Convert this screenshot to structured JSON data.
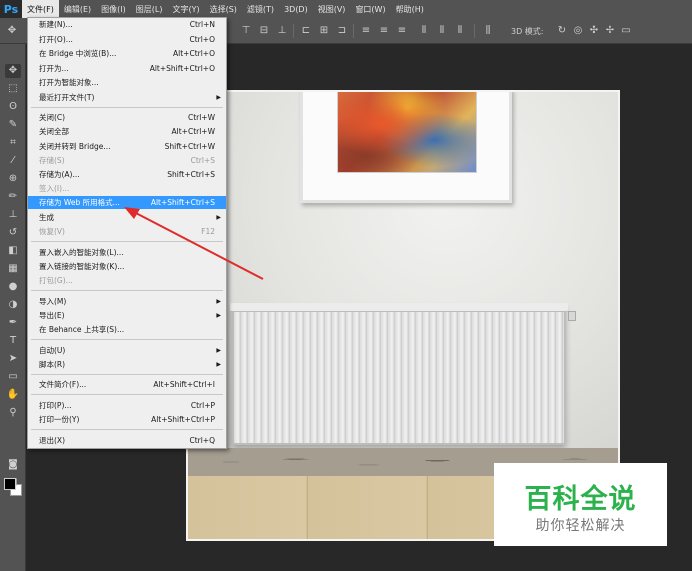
{
  "app": {
    "logo": "Ps"
  },
  "menubar": {
    "items": [
      {
        "label": "文件(F)",
        "active": true
      },
      {
        "label": "编辑(E)"
      },
      {
        "label": "图像(I)"
      },
      {
        "label": "图层(L)"
      },
      {
        "label": "文字(Y)"
      },
      {
        "label": "选择(S)"
      },
      {
        "label": "滤镜(T)"
      },
      {
        "label": "3D(D)"
      },
      {
        "label": "视图(V)"
      },
      {
        "label": "窗口(W)"
      },
      {
        "label": "帮助(H)"
      }
    ]
  },
  "optionsbar": {
    "mode_label": "3D 模式:"
  },
  "file_menu": {
    "items": [
      {
        "label": "新建(N)...",
        "shortcut": "Ctrl+N"
      },
      {
        "label": "打开(O)...",
        "shortcut": "Ctrl+O"
      },
      {
        "label": "在 Bridge 中浏览(B)...",
        "shortcut": "Alt+Ctrl+O"
      },
      {
        "label": "打开为...",
        "shortcut": "Alt+Shift+Ctrl+O"
      },
      {
        "label": "打开为智能对象..."
      },
      {
        "label": "最近打开文件(T)",
        "submenu": true
      },
      {
        "label": "关闭(C)",
        "shortcut": "Ctrl+W"
      },
      {
        "label": "关闭全部",
        "shortcut": "Alt+Ctrl+W"
      },
      {
        "label": "关闭并转到 Bridge...",
        "shortcut": "Shift+Ctrl+W"
      },
      {
        "label": "存储(S)",
        "shortcut": "Ctrl+S",
        "disabled": true
      },
      {
        "label": "存储为(A)...",
        "shortcut": "Shift+Ctrl+S"
      },
      {
        "label": "签入(I)...",
        "disabled": true
      },
      {
        "label": "存储为 Web 所用格式...",
        "shortcut": "Alt+Shift+Ctrl+S",
        "highlighted": true
      },
      {
        "label": "生成",
        "submenu": true
      },
      {
        "label": "恢复(V)",
        "shortcut": "F12",
        "disabled": true
      },
      {
        "label": "置入嵌入的智能对象(L)..."
      },
      {
        "label": "置入链接的智能对象(K)..."
      },
      {
        "label": "打包(G)...",
        "disabled": true
      },
      {
        "label": "导入(M)",
        "submenu": true
      },
      {
        "label": "导出(E)",
        "submenu": true
      },
      {
        "label": "在 Behance 上共享(S)..."
      },
      {
        "label": "自动(U)",
        "submenu": true
      },
      {
        "label": "脚本(R)",
        "submenu": true
      },
      {
        "label": "文件简介(F)...",
        "shortcut": "Alt+Shift+Ctrl+I"
      },
      {
        "label": "打印(P)...",
        "shortcut": "Ctrl+P"
      },
      {
        "label": "打印一份(Y)",
        "shortcut": "Alt+Shift+Ctrl+P"
      },
      {
        "label": "退出(X)",
        "shortcut": "Ctrl+Q"
      }
    ]
  },
  "submenu_arrow": "▶",
  "watermark": {
    "title": "百科全说",
    "subtitle": "助你轻松解决"
  }
}
